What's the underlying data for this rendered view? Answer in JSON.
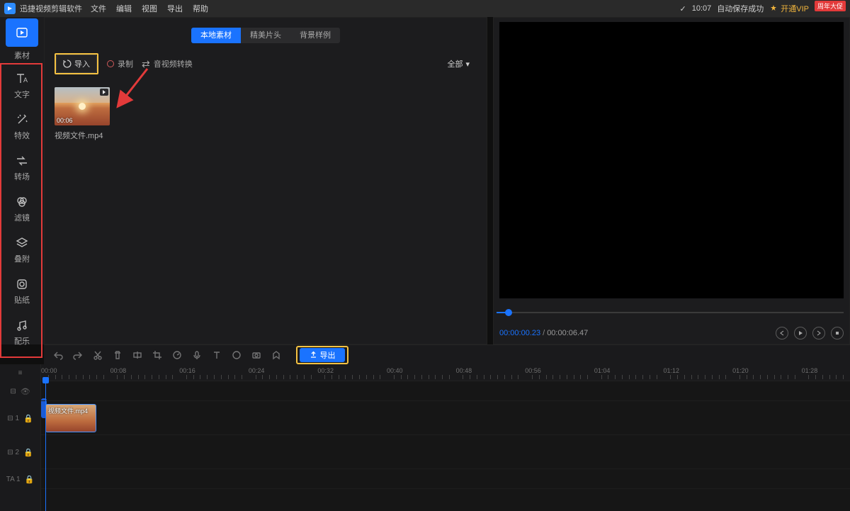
{
  "titlebar": {
    "app_name": "迅捷视频剪辑软件",
    "menus": [
      "文件",
      "编辑",
      "视图",
      "导出",
      "帮助"
    ],
    "autosave_prefix": "✓",
    "autosave_time": "10:07",
    "autosave_text": "自动保存成功",
    "vip_text": "开通VIP",
    "badge": "周年大促"
  },
  "sidebar": [
    {
      "label": "素材",
      "icon": "play"
    },
    {
      "label": "文字",
      "icon": "text"
    },
    {
      "label": "特效",
      "icon": "magic"
    },
    {
      "label": "转场",
      "icon": "transition"
    },
    {
      "label": "滤镜",
      "icon": "filter"
    },
    {
      "label": "叠附",
      "icon": "layers"
    },
    {
      "label": "贴纸",
      "icon": "sticker"
    },
    {
      "label": "配乐",
      "icon": "music"
    }
  ],
  "media": {
    "tabs": [
      "本地素材",
      "精美片头",
      "背景样例"
    ],
    "active_tab": 0,
    "import_label": "导入",
    "record_label": "录制",
    "convert_label": "音视频转换",
    "filter_label": "全部",
    "clip": {
      "name": "视频文件.mp4",
      "duration": "00:06"
    }
  },
  "preview": {
    "cur": "00:00:00.23",
    "total": "00:00:06.47"
  },
  "toolbar": {
    "export_label": "导出"
  },
  "timeline": {
    "ruler": [
      "00:00",
      "00:08",
      "00:16",
      "00:24",
      "00:32",
      "00:40",
      "00:48",
      "00:56",
      "01:04",
      "01:12",
      "01:20",
      "01:28"
    ],
    "tracks_left": [
      "≡",
      "⊟",
      "⊟ 1",
      "⊟ 2",
      "TA 1"
    ],
    "clip_label": "视频文件.mp4"
  }
}
